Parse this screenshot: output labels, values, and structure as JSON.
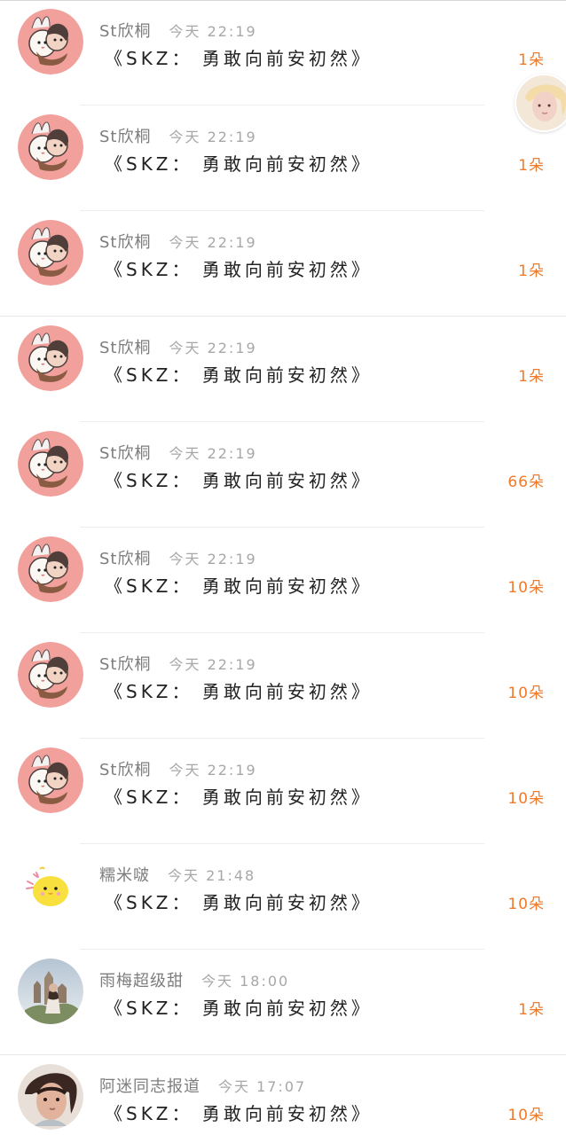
{
  "items": [
    {
      "name": "St欣桐",
      "time": "今天 22:19",
      "title": "《SKZ： 勇敢向前安初然》",
      "count": "1朵",
      "avatar_icon": "pink-bunny-avatar-icon"
    },
    {
      "name": "St欣桐",
      "time": "今天 22:19",
      "title": "《SKZ： 勇敢向前安初然》",
      "count": "1朵",
      "avatar_icon": "pink-bunny-avatar-icon"
    },
    {
      "name": "St欣桐",
      "time": "今天 22:19",
      "title": "《SKZ： 勇敢向前安初然》",
      "count": "1朵",
      "avatar_icon": "pink-bunny-avatar-icon"
    },
    {
      "name": "St欣桐",
      "time": "今天 22:19",
      "title": "《SKZ： 勇敢向前安初然》",
      "count": "1朵",
      "avatar_icon": "pink-bunny-avatar-icon"
    },
    {
      "name": "St欣桐",
      "time": "今天 22:19",
      "title": "《SKZ： 勇敢向前安初然》",
      "count": "66朵",
      "avatar_icon": "pink-bunny-avatar-icon"
    },
    {
      "name": "St欣桐",
      "time": "今天 22:19",
      "title": "《SKZ： 勇敢向前安初然》",
      "count": "10朵",
      "avatar_icon": "pink-bunny-avatar-icon"
    },
    {
      "name": "St欣桐",
      "time": "今天 22:19",
      "title": "《SKZ： 勇敢向前安初然》",
      "count": "10朵",
      "avatar_icon": "pink-bunny-avatar-icon"
    },
    {
      "name": "St欣桐",
      "time": "今天 22:19",
      "title": "《SKZ： 勇敢向前安初然》",
      "count": "10朵",
      "avatar_icon": "pink-bunny-avatar-icon"
    },
    {
      "name": "糯米啵",
      "time": "今天 21:48",
      "title": "《SKZ： 勇敢向前安初然》",
      "count": "10朵",
      "avatar_icon": "yellow-chick-avatar-icon"
    },
    {
      "name": "雨梅超级甜",
      "time": "今天 18:00",
      "title": "《SKZ： 勇敢向前安初然》",
      "count": "1朵",
      "avatar_icon": "castle-photo-avatar-icon"
    },
    {
      "name": "阿迷同志报道",
      "time": "今天 17:07",
      "title": "《SKZ： 勇敢向前安初然》",
      "count": "10朵",
      "avatar_icon": "person-photo-avatar-icon"
    }
  ],
  "floating_avatar_icon": "floating-profile-avatar-icon",
  "colors": {
    "name": "#7d7d7d",
    "time": "#a7a7a7",
    "title": "#222222",
    "count": "#f07a2a",
    "divider": "#eeeeee",
    "avatar_pink": "#f2a09b"
  }
}
